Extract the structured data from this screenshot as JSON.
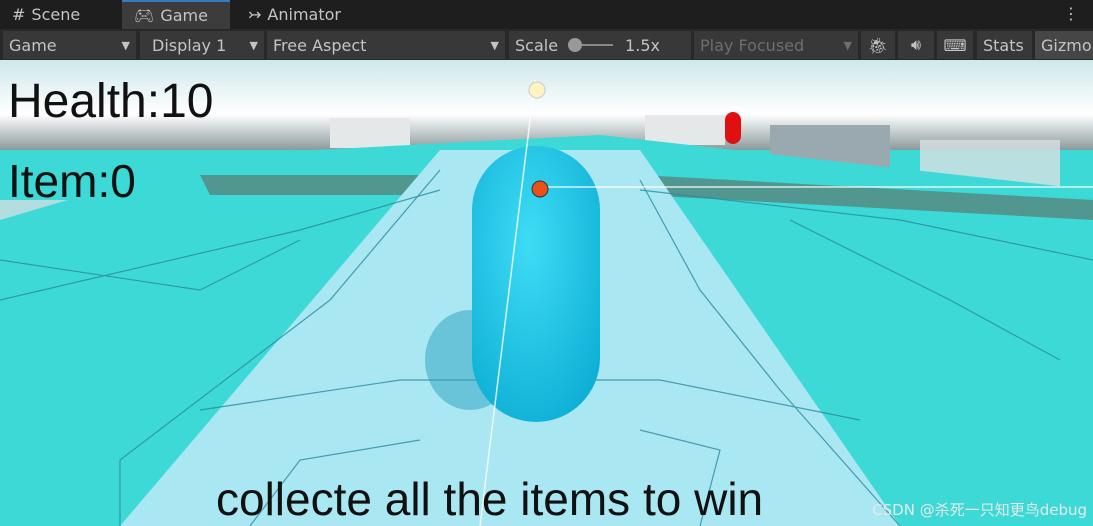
{
  "tabs": [
    {
      "label": "Scene",
      "icon": "hash-icon"
    },
    {
      "label": "Game",
      "icon": "gamepad-icon",
      "active": true
    },
    {
      "label": "Animator",
      "icon": "animator-icon"
    }
  ],
  "toolbar": {
    "mode": "Game",
    "display": "Display 1",
    "aspect": "Free Aspect",
    "scale_label": "Scale",
    "scale_value": "1.5x",
    "play_focused": "Play Focused",
    "stats": "Stats",
    "gizmos": "Gizmo"
  },
  "hud": {
    "health": "Health:10",
    "item": "Item:0",
    "message": "collecte all the items to win"
  },
  "watermark": "CSDN @杀死一只知更鸟debug",
  "colors": {
    "accent": "#3a79bb",
    "ground": "#3dd9d6",
    "player": "#1ec3e6"
  }
}
